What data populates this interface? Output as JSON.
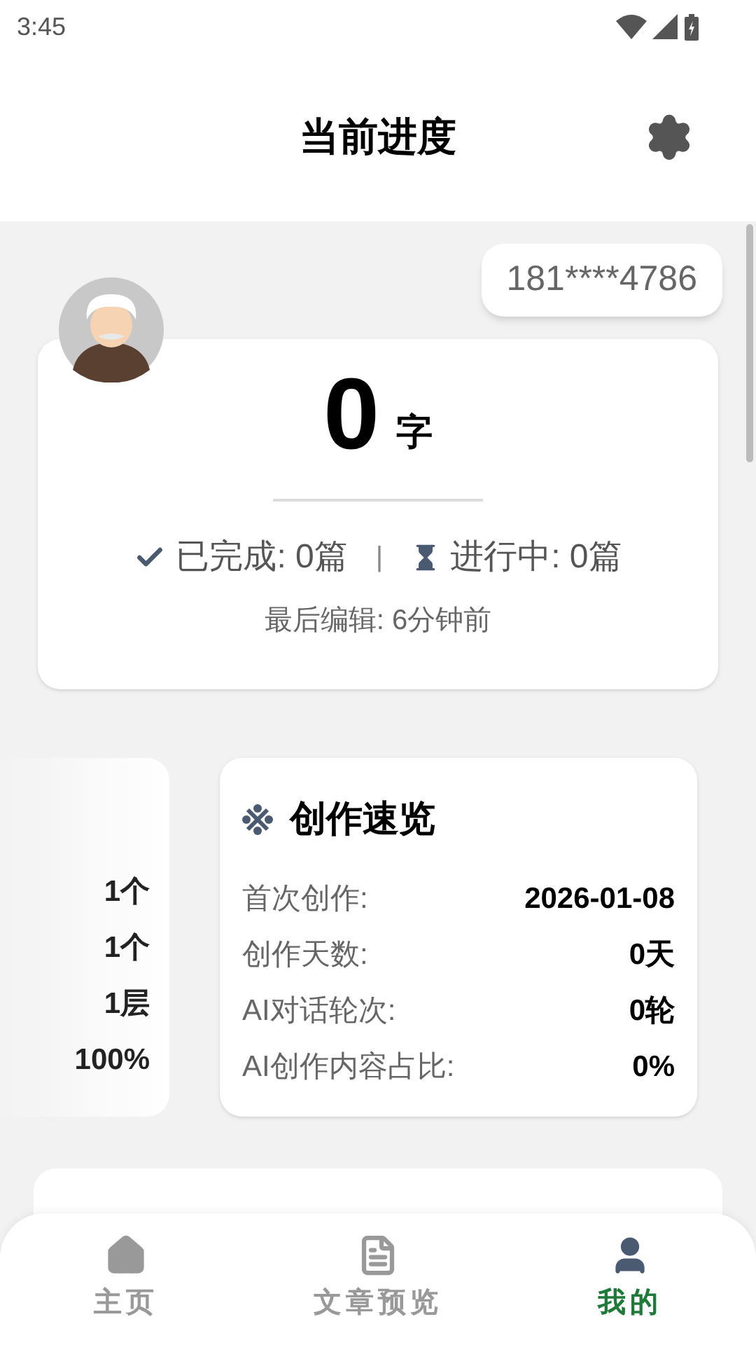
{
  "status_bar": {
    "time": "3:45"
  },
  "header": {
    "title": "当前进度"
  },
  "account": {
    "phone": "181****4786"
  },
  "summary": {
    "count": "0",
    "unit": "字",
    "done": "已完成: 0篇",
    "separator": "|",
    "in_progress": "进行中: 0篇",
    "last_edit": "最后编辑: 6分钟前"
  },
  "side_card": {
    "values": [
      "1个",
      "1个",
      "1层",
      "100%"
    ]
  },
  "overview": {
    "title": "创作速览",
    "rows": [
      {
        "label": "首次创作:",
        "value": "2026-01-08"
      },
      {
        "label": "创作天数:",
        "value": "0天"
      },
      {
        "label": "AI对话轮次:",
        "value": "0轮"
      },
      {
        "label": "AI创作内容占比:",
        "value": "0%"
      }
    ]
  },
  "nav": [
    {
      "label": "主页",
      "kind": "home",
      "selected": false
    },
    {
      "label": "文章预览",
      "kind": "doc",
      "selected": false
    },
    {
      "label": "我的",
      "kind": "user",
      "selected": true
    }
  ]
}
